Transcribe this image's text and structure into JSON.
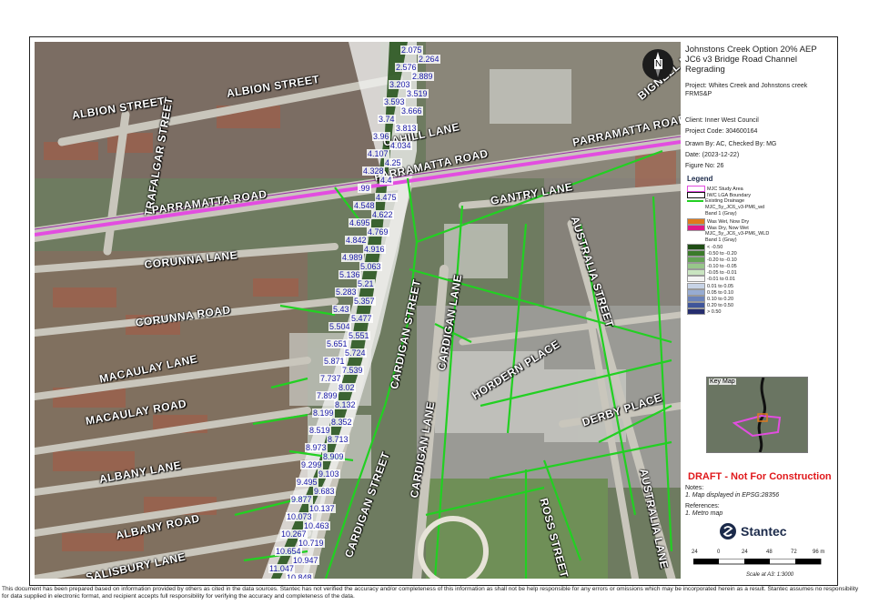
{
  "title": "Johnstons Creek Option 20% AEP JC6 v3 Bridge Road Channel Regrading",
  "project_label": "Project:",
  "project": "Whites Creek and Johnstons creek FRMS&P",
  "client": "Client: Inner West Council",
  "project_code": "Project Code: 304600164",
  "drawn_by": "Drawn By: AC, Checked By: MG",
  "date": "Date: (2023-12-22)",
  "figure_no": "Figure No: 26",
  "legend": {
    "heading": "Legend",
    "items": [
      {
        "label": "MJC Study Area",
        "color": "#e24de0",
        "kind": "outline"
      },
      {
        "label": "IWC LGA Boundary",
        "color": "#111111",
        "kind": "outline"
      },
      {
        "label": "Existing Drainage",
        "color": "#22d022",
        "kind": "line"
      },
      {
        "label": "MJC_5y_JC6_v3-PM6_wd",
        "color": "",
        "kind": "text"
      },
      {
        "label": "Band 1 (Gray)",
        "color": "",
        "kind": "text"
      },
      {
        "label": "Was Wet, Now Dry",
        "color": "#e07a1c",
        "kind": "fill"
      },
      {
        "label": "Was Dry, Now Wet",
        "color": "#e0188a",
        "kind": "fill"
      },
      {
        "label": "MJC_5y_JC6_v3-PM6_WLD",
        "color": "",
        "kind": "text"
      },
      {
        "label": "Band 1 (Gray)",
        "color": "",
        "kind": "text"
      },
      {
        "label": "< -0.50",
        "color": "#1f4d14",
        "kind": "fill"
      },
      {
        "label": "-0.50 to -0.20",
        "color": "#3b7a2a",
        "kind": "fill"
      },
      {
        "label": "-0.20 to -0.10",
        "color": "#63a354",
        "kind": "fill"
      },
      {
        "label": "-0.10 to -0.05",
        "color": "#97c68a",
        "kind": "fill"
      },
      {
        "label": "-0.05 to -0.01",
        "color": "#c9e4c0",
        "kind": "fill"
      },
      {
        "label": "-0.01 to 0.01",
        "color": "#f4f4f4",
        "kind": "fill"
      },
      {
        "label": "0.01 to 0.05",
        "color": "#c7d3e6",
        "kind": "fill"
      },
      {
        "label": "0.05 to 0.10",
        "color": "#97acd2",
        "kind": "fill"
      },
      {
        "label": "0.10 to 0.20",
        "color": "#6a82ba",
        "kind": "fill"
      },
      {
        "label": "0.20 to 0.50",
        "color": "#3f559a",
        "kind": "fill"
      },
      {
        "label": "> 0.50",
        "color": "#252d6e",
        "kind": "fill"
      }
    ]
  },
  "key_map_title": "Key Map",
  "draft": "DRAFT - Not For Construction",
  "notes_heading": "Notes:",
  "notes": "1. Map displayed in EPSG:28356",
  "references_heading": "References:",
  "references": "1. Metro map",
  "logo_text": "Stantec",
  "scale_ticks": [
    "24",
    "0",
    "24",
    "48",
    "72",
    "96 m"
  ],
  "scale_text": "Scale at A3: 1:3000",
  "north_label": "N",
  "disclaimer": "This document has been prepared based on information provided by others as cited in the data sources. Stantec has not verified the accuracy and/or completeness of this information as shall not be help responsible for any errors or omissions which may be incorporated herein as a result. Stantec assumes no responsibility for data supplied in electronic format, and recipient accepts full responsibility for verifying the accuracy and completeness of the data.",
  "streets": [
    "ALBION STREET",
    "ALBION STREET",
    "TRAFALGAR STREET",
    "CAHILL LANE",
    "PARRAMATTA ROAD",
    "PARRAMATTA ROAD",
    "PARRAMATTA ROAD",
    "BIGNELL LANE",
    "GANTRY LANE",
    "CORUNNA LANE",
    "CORUNNA ROAD",
    "AUSTRALIA STREET",
    "MACAULAY LANE",
    "MACAULAY ROAD",
    "CARDIGAN STREET",
    "CARDIGAN LANE",
    "HORDERN PLACE",
    "DERBY PLACE",
    "ALBANY LANE",
    "ALBANY ROAD",
    "CARDIGAN STREET",
    "CARDIGAN LANE",
    "ROSS STREET",
    "AUSTRALIA LANE",
    "SALISBURY LANE"
  ],
  "levels": [
    "2.075",
    "2.264",
    "2.576",
    "2.889",
    "3.203",
    "3.519",
    "3.593",
    "3.666",
    "3.74",
    "3.813",
    "3.96",
    "4.034",
    "4.107",
    "4.25",
    "4.328",
    "4.4",
    ".99",
    "4.475",
    "4.548",
    "4.622",
    "4.695",
    "4.769",
    "4.842",
    "4.916",
    "4.989",
    "5.063",
    "5.136",
    "5.21",
    "5.283",
    "5.357",
    "5.43",
    "5.477",
    "5.504",
    "5.551",
    "5.651",
    "5.724",
    "5.871",
    "7.539",
    "7.737",
    "8.02",
    "7.899",
    "8.132",
    "8.199",
    "8.352",
    "8.519",
    "8.713",
    "8.973",
    "8.909",
    "9.299",
    "9.103",
    "9.495",
    "9.683",
    "9.877",
    "10.137",
    "10.073",
    "10.463",
    "10.267",
    "10.719",
    "10.654",
    "10.947",
    "11.047",
    "10.848"
  ]
}
